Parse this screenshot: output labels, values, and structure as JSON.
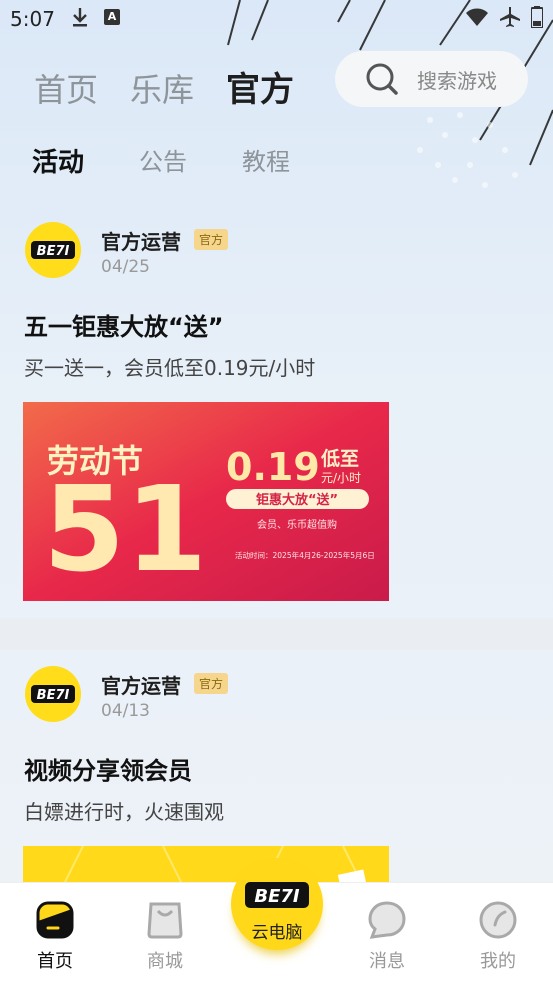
{
  "status_bar": {
    "time": "5:07"
  },
  "top_nav": {
    "tabs": [
      {
        "label": "首页"
      },
      {
        "label": "乐库"
      },
      {
        "label": "官方"
      }
    ],
    "search_placeholder": "搜索游戏"
  },
  "sub_tabs": [
    {
      "label": "活动"
    },
    {
      "label": "公告"
    },
    {
      "label": "教程"
    }
  ],
  "posts": [
    {
      "author": "官方运营",
      "badge": "官方",
      "date": "04/25",
      "title": "五一钜惠大放“送”",
      "desc": "买一送一，会员低至0.19元/小时",
      "banner": {
        "headline": "劳动节",
        "big_number": "51",
        "price": "0.19",
        "price_label_top": "低至",
        "price_label_bottom": "元/小时",
        "pill": "钜惠大放“送”",
        "sub": "会员、乐币超值购",
        "period": "活动时间：2025年4月26-2025年5月6日",
        "bg_color": "#e8284a"
      }
    },
    {
      "author": "官方运营",
      "badge": "官方",
      "date": "04/13",
      "title": "视频分享领会员",
      "desc": "白嫖进行时，火速围观",
      "banner": {
        "bg_color": "#ffd91a"
      }
    }
  ],
  "logo_text": "BE7I",
  "bottom_tabs": [
    {
      "label": "首页",
      "icon": "home-icon"
    },
    {
      "label": "商城",
      "icon": "shop-icon"
    },
    {
      "label": "云电脑",
      "icon": "cloud-pc-icon"
    },
    {
      "label": "消息",
      "icon": "message-icon"
    },
    {
      "label": "我的",
      "icon": "profile-icon"
    }
  ],
  "colors": {
    "brand_yellow": "#ffd81a",
    "badge_bg": "#f6d68d"
  }
}
